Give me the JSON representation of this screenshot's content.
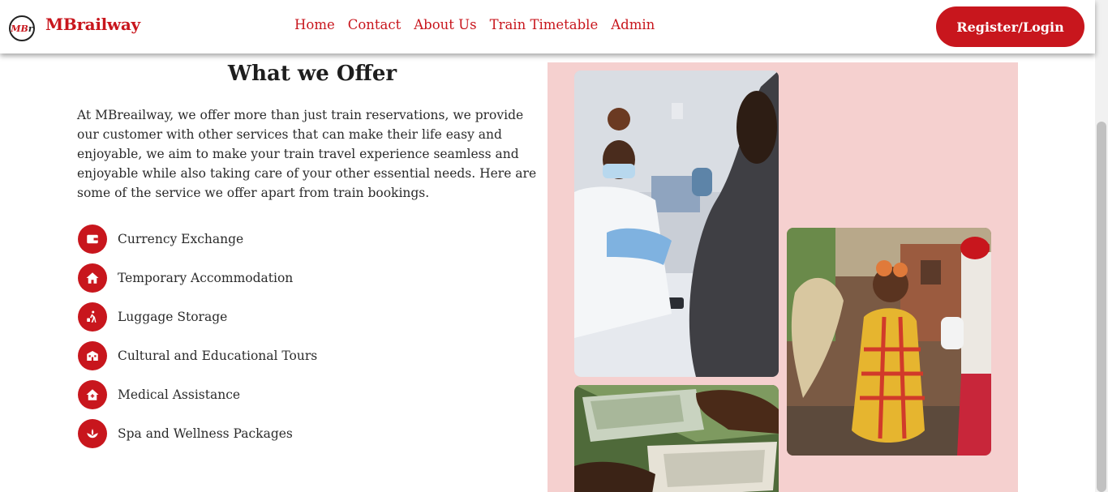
{
  "header": {
    "logo_text": "MBr",
    "brand": "MBrailway",
    "nav": [
      "Home",
      "Contact",
      "About Us",
      "Train Timetable",
      "Admin"
    ],
    "login_label": "Register/Login"
  },
  "section": {
    "title": "What we Offer",
    "intro": "At MBreailway, we offer more than just train reservations, we provide our customer with other services that can make their life easy and enjoyable, we aim to make your train travel experience seamless and enjoyable while also taking care of your other essential needs. Here are some of the service we offer apart from train bookings.",
    "services": [
      {
        "label": "Currency Exchange",
        "icon": "wallet-icon"
      },
      {
        "label": "Temporary Accommodation",
        "icon": "home-icon"
      },
      {
        "label": "Luggage Storage",
        "icon": "luggage-icon"
      },
      {
        "label": "Cultural and Educational Tours",
        "icon": "building-icon"
      },
      {
        "label": "Medical Assistance",
        "icon": "medical-house-icon"
      },
      {
        "label": "Spa and Wellness Packages",
        "icon": "lotus-icon"
      }
    ]
  },
  "images": [
    {
      "icon": "doctor-patient-photo"
    },
    {
      "icon": "cultural-dancer-photo"
    },
    {
      "icon": "currency-exchange-photo"
    }
  ],
  "colors": {
    "accent": "#c8161d",
    "panel": "#f5d0cf"
  }
}
